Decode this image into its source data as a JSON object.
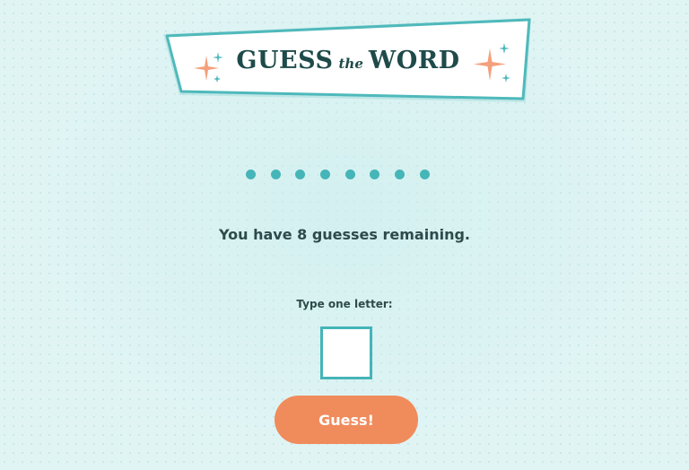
{
  "banner": {
    "word1": "GUESS",
    "joiner": "the",
    "word2": "WORD"
  },
  "word": {
    "letter_slots": [
      "",
      "",
      "",
      "",
      "",
      "",
      "",
      ""
    ]
  },
  "status": {
    "message": "You have 8 guesses remaining."
  },
  "input": {
    "label": "Type one letter:",
    "value": ""
  },
  "actions": {
    "guess_label": "Guess!"
  },
  "colors": {
    "background": "#e0f4f4",
    "teal_accent": "#45b5b8",
    "button_orange": "#f08b5c",
    "sparkle_orange": "#f4a07c",
    "sparkle_teal": "#4fb9bb",
    "text_dark": "#2e4a4a",
    "title_dark": "#1f4a4a"
  },
  "icons": {
    "left_sparkle": "sparkle-icon",
    "right_sparkle": "sparkle-icon"
  }
}
